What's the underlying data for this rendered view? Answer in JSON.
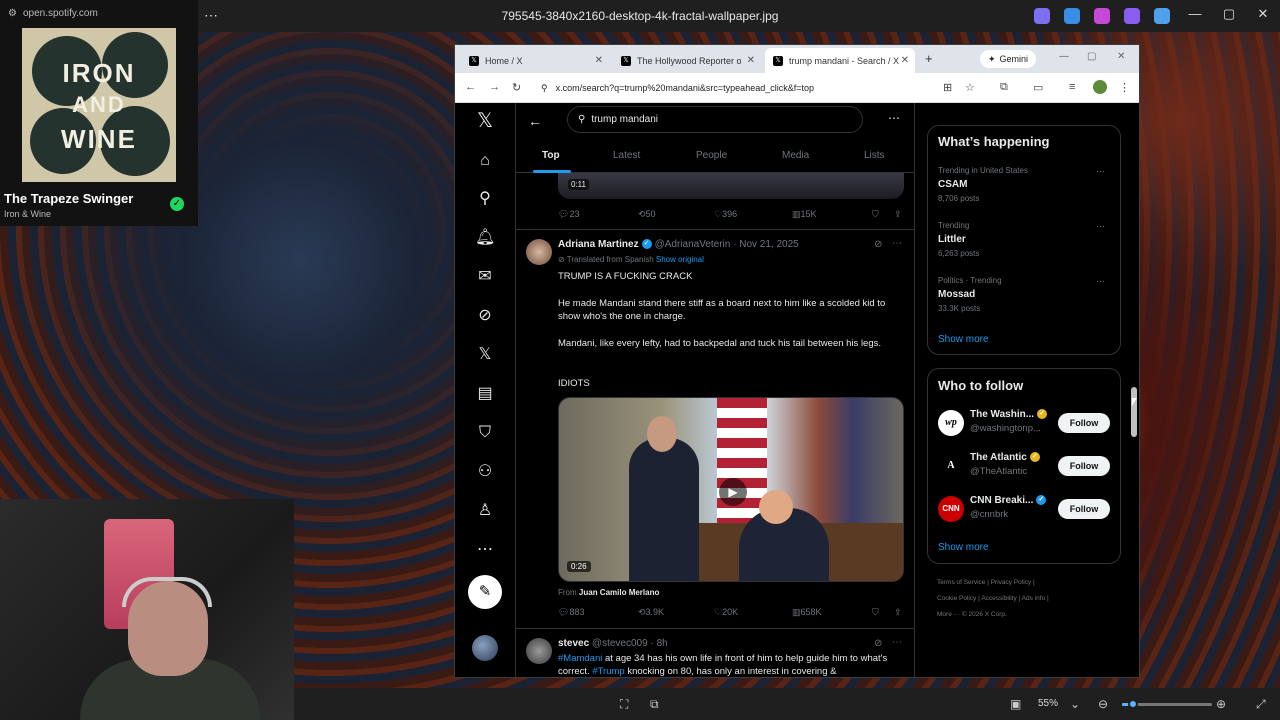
{
  "viewer": {
    "title": "795545-3840x2160-desktop-4k-fractal-wallpaper.jpg",
    "zoom": "55%",
    "zoom_level": 0.12
  },
  "spotify": {
    "url": "open.spotify.com",
    "album_top": "IRON",
    "album_mid": "AND",
    "album_bot": "WINE",
    "song": "The Trapeze Swinger",
    "artist": "Iron & Wine"
  },
  "browser": {
    "tabs": [
      {
        "label": "Home / X"
      },
      {
        "label": "The Hollywood Reporter on X"
      },
      {
        "label": "trump mandani - Search / X"
      }
    ],
    "gemini": "Gemini",
    "url": "x.com/search?q=trump%20mandani&src=typeahead_click&f=top"
  },
  "search": {
    "query": "trump mandani",
    "filters": [
      "Top",
      "Latest",
      "People",
      "Media",
      "Lists"
    ]
  },
  "prev_post": {
    "time": "0:11",
    "replies": "23",
    "reposts": "50",
    "likes": "396",
    "views": "15K"
  },
  "post1": {
    "name": "Adriana Martinez",
    "handle": "@AdrianaVeterin",
    "date": "Nov 21, 2025",
    "translated": "Translated from Spanish",
    "show_original": "Show original",
    "lines": [
      "TRUMP IS A FUCKING CRACK",
      "He made Mandani stand there stiff as a board next to him like a scolded kid to show who's the one in charge.",
      "Mandani, like every lefty, had to backpedal and tuck his tail between his legs.",
      "IDIOTS"
    ],
    "duration": "0:26",
    "from_prefix": "From",
    "from_name": "Juan Camilo Merlano",
    "replies": "883",
    "reposts": "3.9K",
    "likes": "20K",
    "views": "658K"
  },
  "post2": {
    "name": "stevec",
    "handle": "@stevec009",
    "time": "8h",
    "tag1": "#Mamdani",
    "text1": " at age 34 has his own life in front of him to help guide him to what's correct. ",
    "tag2": "#Trump",
    "text2": " knocking on 80, has only an interest in covering &"
  },
  "trends": {
    "title": "What’s happening",
    "items": [
      {
        "meta": "Trending in United States",
        "name": "CSAM",
        "count": "8,706 posts"
      },
      {
        "meta": "Trending",
        "name": "Littler",
        "count": "6,263 posts"
      },
      {
        "meta": "Politics · Trending",
        "name": "Mossad",
        "count": "33.3K posts"
      }
    ],
    "show_more": "Show more"
  },
  "who_to_follow": {
    "title": "Who to follow",
    "items": [
      {
        "name": "The Washin...",
        "handle": "@washingtonp...",
        "avatar": "wp"
      },
      {
        "name": "The Atlantic",
        "handle": "@TheAtlantic",
        "avatar": "A"
      },
      {
        "name": "CNN Breaki...",
        "handle": "@cnnbrk",
        "avatar": "CNN"
      }
    ],
    "follow_label": "Follow",
    "show_more": "Show more"
  },
  "footer": {
    "line1": "Terms of Service | Privacy Policy |",
    "line2": "Cookie Policy | Accessibility | Ads info |",
    "line3": "More ··· © 2026 X Corp."
  }
}
